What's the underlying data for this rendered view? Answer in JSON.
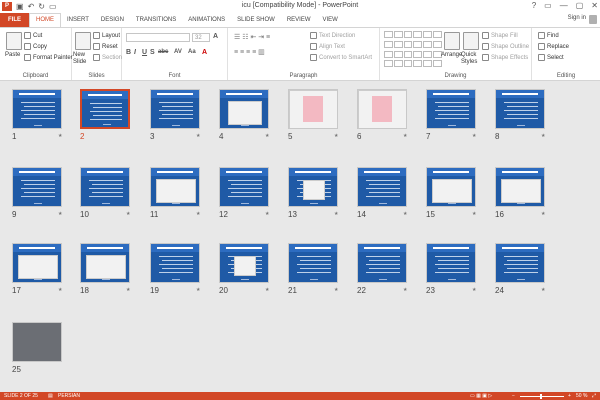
{
  "window": {
    "title": "icu [Compatibility Mode] - PowerPoint",
    "app_icon": "P",
    "controls": [
      "?",
      "▭",
      "—",
      "▢",
      "✕"
    ]
  },
  "quick_access": [
    "save-icon",
    "undo-icon",
    "redo-icon",
    "slideshow-icon"
  ],
  "tabs": [
    {
      "label": "FILE"
    },
    {
      "label": "HOME"
    },
    {
      "label": "INSERT"
    },
    {
      "label": "DESIGN"
    },
    {
      "label": "TRANSITIONS"
    },
    {
      "label": "ANIMATIONS"
    },
    {
      "label": "SLIDE SHOW"
    },
    {
      "label": "REVIEW"
    },
    {
      "label": "VIEW"
    }
  ],
  "active_tab": "HOME",
  "user": {
    "label": "Sign in"
  },
  "ribbon": {
    "clipboard": {
      "paste": "Paste",
      "cut": "Cut",
      "copy": "Copy",
      "format_painter": "Format Painter",
      "label": "Clipboard"
    },
    "slides": {
      "new_slide": "New Slide",
      "layout": "Layout",
      "reset": "Reset",
      "section": "Section",
      "label": "Slides"
    },
    "font": {
      "label": "Font",
      "size": "32",
      "bold": "B",
      "italic": "I",
      "underline": "U",
      "strike": "S",
      "shadow": "abc",
      "spacing": "AV",
      "case": "Aa",
      "color": "A"
    },
    "paragraph": {
      "text_direction": "Text Direction",
      "align_text": "Align Text",
      "convert": "Convert to SmartArt",
      "label": "Paragraph"
    },
    "drawing": {
      "arrange": "Arrange",
      "quick_styles": "Quick Styles",
      "shape_fill": "Shape Fill",
      "shape_outline": "Shape Outline",
      "shape_effects": "Shape Effects",
      "label": "Drawing"
    },
    "editing": {
      "find": "Find",
      "replace": "Replace",
      "select": "Select",
      "label": "Editing"
    }
  },
  "slides": [
    {
      "n": "1"
    },
    {
      "n": "2"
    },
    {
      "n": "3"
    },
    {
      "n": "4"
    },
    {
      "n": "5"
    },
    {
      "n": "6"
    },
    {
      "n": "7"
    },
    {
      "n": "8"
    },
    {
      "n": "9"
    },
    {
      "n": "10"
    },
    {
      "n": "11"
    },
    {
      "n": "12"
    },
    {
      "n": "13"
    },
    {
      "n": "14"
    },
    {
      "n": "15"
    },
    {
      "n": "16"
    },
    {
      "n": "17"
    },
    {
      "n": "18"
    },
    {
      "n": "19"
    },
    {
      "n": "20"
    },
    {
      "n": "21"
    },
    {
      "n": "22"
    },
    {
      "n": "23"
    },
    {
      "n": "24"
    },
    {
      "n": "25"
    }
  ],
  "selected_slide": "2",
  "colors": {
    "accent": "#d24726",
    "slide_bg": "#1f5aa6"
  },
  "status": {
    "slide_info": "SLIDE 2 OF 25",
    "language": "PERSIAN",
    "zoom": "50 %"
  }
}
